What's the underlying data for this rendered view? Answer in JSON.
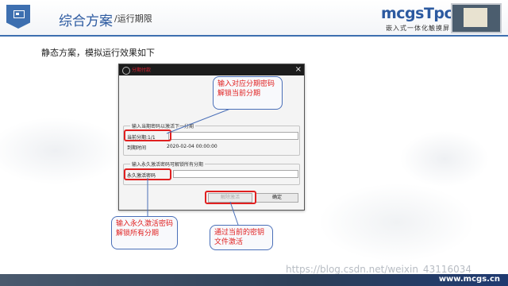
{
  "slide": {
    "title": "综合方案",
    "subtitle": "/运行期限",
    "brand": "mcgsTpc",
    "brand_tagline": "嵌入式一体化触摸屏",
    "intro": "静态方案，模拟运行效果如下",
    "footer_url": "www.mcgs.cn",
    "watermark": "https://blog.csdn.net/weixin_43116034"
  },
  "dialog": {
    "title": "分期付款",
    "close": "×",
    "group1": {
      "label": "输入当期密码以激活下一分期",
      "current_period_label": "当前分期:1/1",
      "current_period_value": "",
      "expire_label": "到期时间",
      "expire_value": "2020-02-04 00:00:00"
    },
    "group2": {
      "label": "输入永久激活密码可解锁所有分期",
      "perm_label": "永久激活密码",
      "perm_value": ""
    },
    "buttons": {
      "unlock": "解除激活",
      "ok": "确定"
    }
  },
  "callouts": {
    "top": "输入对应分期密码解锁当前分期",
    "bottom_left": "输入永久激活密码解锁所有分期",
    "bottom_right": "通过当前的密钥文件激活"
  },
  "colors": {
    "accent": "#2c5aa0",
    "highlight": "#e02020"
  }
}
